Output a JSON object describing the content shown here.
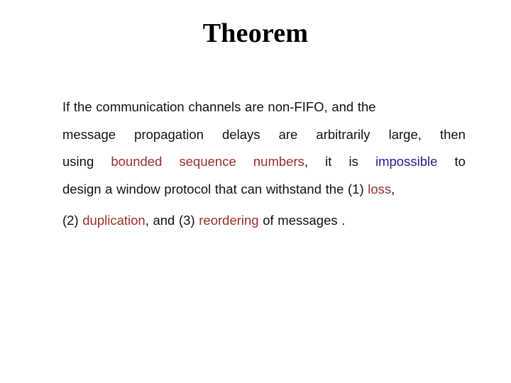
{
  "slide": {
    "title": "Theorem",
    "colors": {
      "background": "#ffffff",
      "title": "#000000",
      "body": "#111111",
      "highlight_red": "#9a2f27",
      "highlight_blue": "#201f8e"
    },
    "body": {
      "full_text": "If the communication channels are non-FIFO, and the message propagation delays are arbitrarily large, then using bounded sequence numbers, it is impossible to design a window protocol that can withstand the (1) loss, (2) duplication, and (3) reordering of messages .",
      "lines": [
        {
          "index": 1,
          "justified": false,
          "runs": [
            {
              "text": "If the communication channels are non-FIFO, and the",
              "style": "plain"
            }
          ],
          "words": [
            "If",
            "the",
            "communication",
            "channels",
            "are",
            "non-FIFO,",
            "and",
            "the"
          ]
        },
        {
          "index": 2,
          "justified": true,
          "runs": [
            {
              "text": "message propagation delays are arbitrarily large, then",
              "style": "plain"
            }
          ],
          "words": [
            "message",
            "propagation",
            "delays",
            "are",
            "arbitrarily",
            "large,",
            "then"
          ]
        },
        {
          "index": 3,
          "justified": true,
          "runs": [
            {
              "text": "using ",
              "style": "plain"
            },
            {
              "text": "bounded sequence numbers",
              "style": "red"
            },
            {
              "text": ", it is ",
              "style": "plain"
            },
            {
              "text": "impossible",
              "style": "blue"
            },
            {
              "text": " to",
              "style": "plain"
            }
          ],
          "words": [
            {
              "text": "using",
              "style": "plain"
            },
            {
              "text": "bounded",
              "style": "red"
            },
            {
              "text": "sequence",
              "style": "red"
            },
            {
              "text": "numbers,",
              "style": "red-comma"
            },
            {
              "text": "it",
              "style": "plain"
            },
            {
              "text": "is",
              "style": "plain"
            },
            {
              "text": "impossible",
              "style": "blue"
            },
            {
              "text": "to",
              "style": "plain"
            }
          ]
        },
        {
          "index": 4,
          "justified": false,
          "runs": [
            {
              "text": "design a window protocol that can withstand the (1) ",
              "style": "plain"
            },
            {
              "text": "loss",
              "style": "red"
            },
            {
              "text": ",",
              "style": "plain"
            }
          ]
        },
        {
          "index": 5,
          "justified": false,
          "runs": [
            {
              "text": "(2) ",
              "style": "plain"
            },
            {
              "text": "duplication",
              "style": "red"
            },
            {
              "text": ", and (3) ",
              "style": "plain"
            },
            {
              "text": "reordering",
              "style": "red"
            },
            {
              "text": " of messages .",
              "style": "plain"
            }
          ]
        }
      ]
    },
    "line_text": {
      "l1": "If the communication channels are non-FIFO, and the",
      "l2_w1": "message",
      "l2_w2": "propagation",
      "l2_w3": "delays",
      "l2_w4": "are",
      "l2_w5": "arbitrarily",
      "l2_w6": "large,",
      "l2_w7": "then",
      "l3_w1": "using",
      "l3_w2": "bounded",
      "l3_w3": "sequence",
      "l3_w4": "numbers",
      "l3_w4b": ",",
      "l3_w5": "it",
      "l3_w6": "is",
      "l3_w7": "impossible",
      "l3_w8": "to",
      "l4_a": "design a window protocol that can withstand the (1) ",
      "l4_b": "loss",
      "l4_c": ",",
      "l5_a": "(2) ",
      "l5_b": "duplication",
      "l5_c": ", and (3) ",
      "l5_d": "reordering",
      "l5_e": " of messages ."
    }
  }
}
